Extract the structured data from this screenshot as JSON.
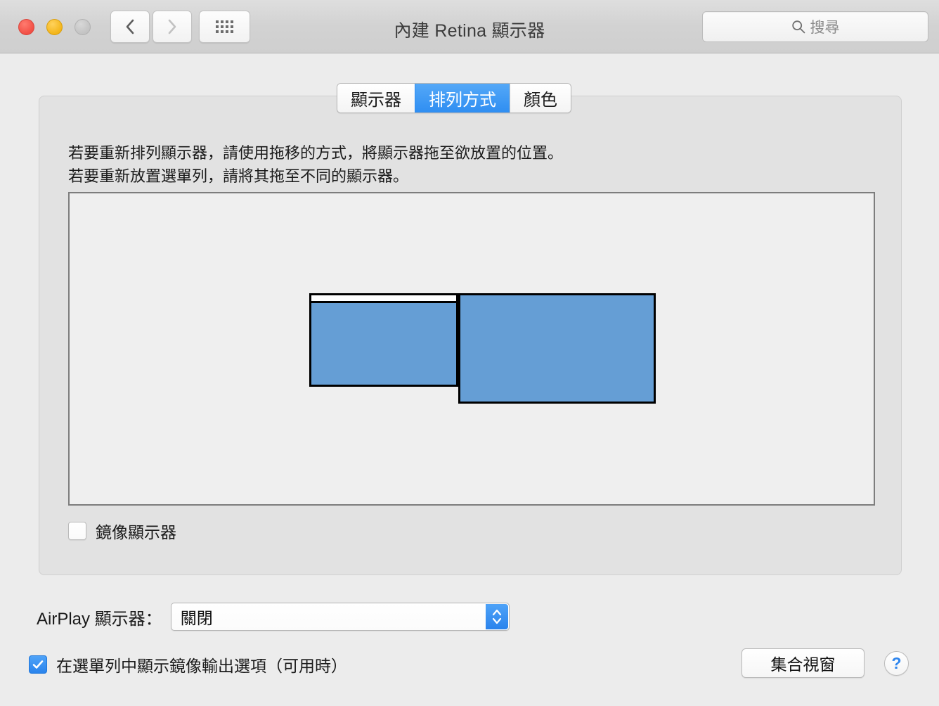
{
  "window": {
    "title": "內建 Retina 顯示器",
    "traffic_lights": {
      "close": "close-button",
      "minimize": "minimize-button",
      "zoom": "zoom-button"
    },
    "nav": {
      "back_icon": "chevron-left-icon",
      "forward_icon": "chevron-right-icon",
      "grid_icon": "grid-dots-icon"
    },
    "search": {
      "placeholder": "搜尋",
      "value": "",
      "icon": "search-icon"
    }
  },
  "tabs": [
    {
      "label": "顯示器",
      "active": false
    },
    {
      "label": "排列方式",
      "active": true
    },
    {
      "label": "顏色",
      "active": false
    }
  ],
  "panel": {
    "hint": "若要重新排列顯示器，請使用拖移的方式，將顯示器拖至欲放置的位置。\n若要重新放置選單列，請將其拖至不同的顯示器。",
    "arrangement": {
      "displays": [
        {
          "name": "display-primary",
          "has_menubar": true
        },
        {
          "name": "display-secondary",
          "has_menubar": false
        }
      ]
    },
    "mirror": {
      "label": "鏡像顯示器",
      "checked": false
    }
  },
  "airplay": {
    "label": "AirPlay 顯示器：",
    "value": "關閉",
    "stepper_icon": "stepper-up-down-icon"
  },
  "footer": {
    "menubar_mirroring": {
      "label": "在選單列中顯示鏡像輸出選項（可用時）",
      "checked": true
    },
    "gather_windows_label": "集合視窗",
    "help_label": "?"
  },
  "colors": {
    "accent_blue": "#2f8ef2",
    "display_fill": "#659ed5",
    "window_bg": "#ececec",
    "panel_bg": "#e2e2e2"
  }
}
